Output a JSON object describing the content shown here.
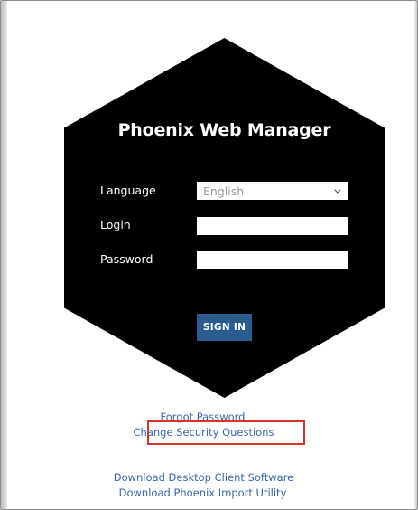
{
  "app": {
    "title": "Phoenix Web Manager"
  },
  "form": {
    "language_label": "Language",
    "language_value": "English",
    "login_label": "Login",
    "login_value": "",
    "password_label": "Password",
    "password_value": "",
    "sign_in_label": "SIGN IN"
  },
  "links": {
    "forgot_password": "Forgot Password",
    "change_security_questions": "Change Security Questions",
    "download_desktop_client": "Download Desktop Client Software",
    "download_import_utility": "Download Phoenix Import Utility"
  },
  "icons": {
    "language_dropdown": "chevron-down-icon"
  },
  "colors": {
    "hexagon_background": "#000000",
    "page_background": "#ffffff",
    "button_background": "#2a5d8e",
    "link_color": "#3a64ad",
    "highlight_border": "#d9342b"
  }
}
